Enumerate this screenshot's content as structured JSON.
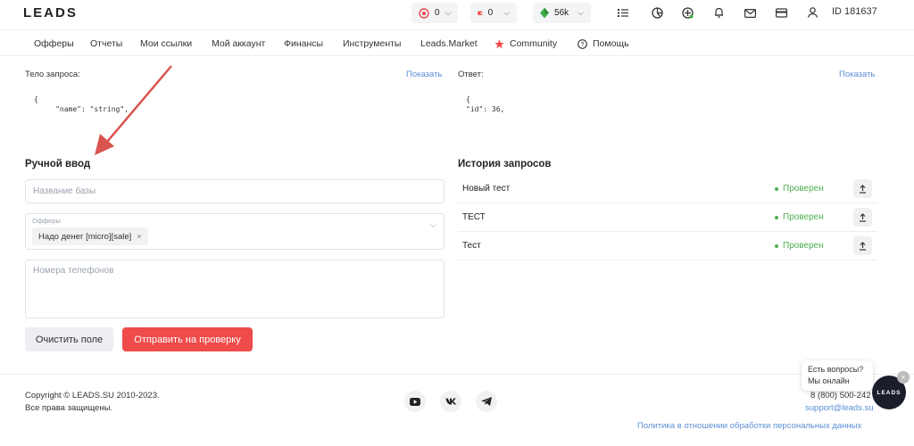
{
  "header": {
    "logo": "LEADS",
    "stat1_value": "0",
    "stat2_value": "0",
    "stat3_value": "56k",
    "user_id": "ID 181637"
  },
  "nav": {
    "items": [
      "Офферы",
      "Отчеты",
      "Мои ссылки",
      "Мой аккаунт",
      "Финансы",
      "Инструменты",
      "Leads.Market",
      "Community",
      "Помощь"
    ]
  },
  "request": {
    "body_label": "Тело запроса:",
    "body_show": "Показать",
    "body_code": "{\n     \"name\": \"string\",",
    "response_label": "Ответ:",
    "response_show": "Показать",
    "response_code": "{\n\"id\": 36,"
  },
  "manual": {
    "title": "Ручной ввод",
    "db_name_placeholder": "Название базы",
    "offers_label": "Офферы",
    "offer_chip": "Надо денег [micro][sale]",
    "phones_placeholder": "Номера телефонов",
    "clear_button": "Очистить поле",
    "submit_button": "Отправить на проверку"
  },
  "history": {
    "title": "История запросов",
    "rows": [
      {
        "name": "Новый тест",
        "status": "Проверен"
      },
      {
        "name": "ТЕСТ",
        "status": "Проверен"
      },
      {
        "name": "Тест",
        "status": "Проверен"
      }
    ]
  },
  "footer": {
    "copyright": "Copyright © LEADS.SU 2010-2023.",
    "rights": "Все права защищены.",
    "phone": "8 (800) 500-242",
    "support": "support@leads.su",
    "policy": "Политика в отношении обработки персональных данных"
  },
  "chat": {
    "question": "Есть вопросы?",
    "online": "Мы онлайн",
    "logo": "LEADS"
  },
  "colors": {
    "accent_red": "#ef4b4b",
    "link_blue": "#5a8fd6",
    "status_green": "#4caf50"
  }
}
